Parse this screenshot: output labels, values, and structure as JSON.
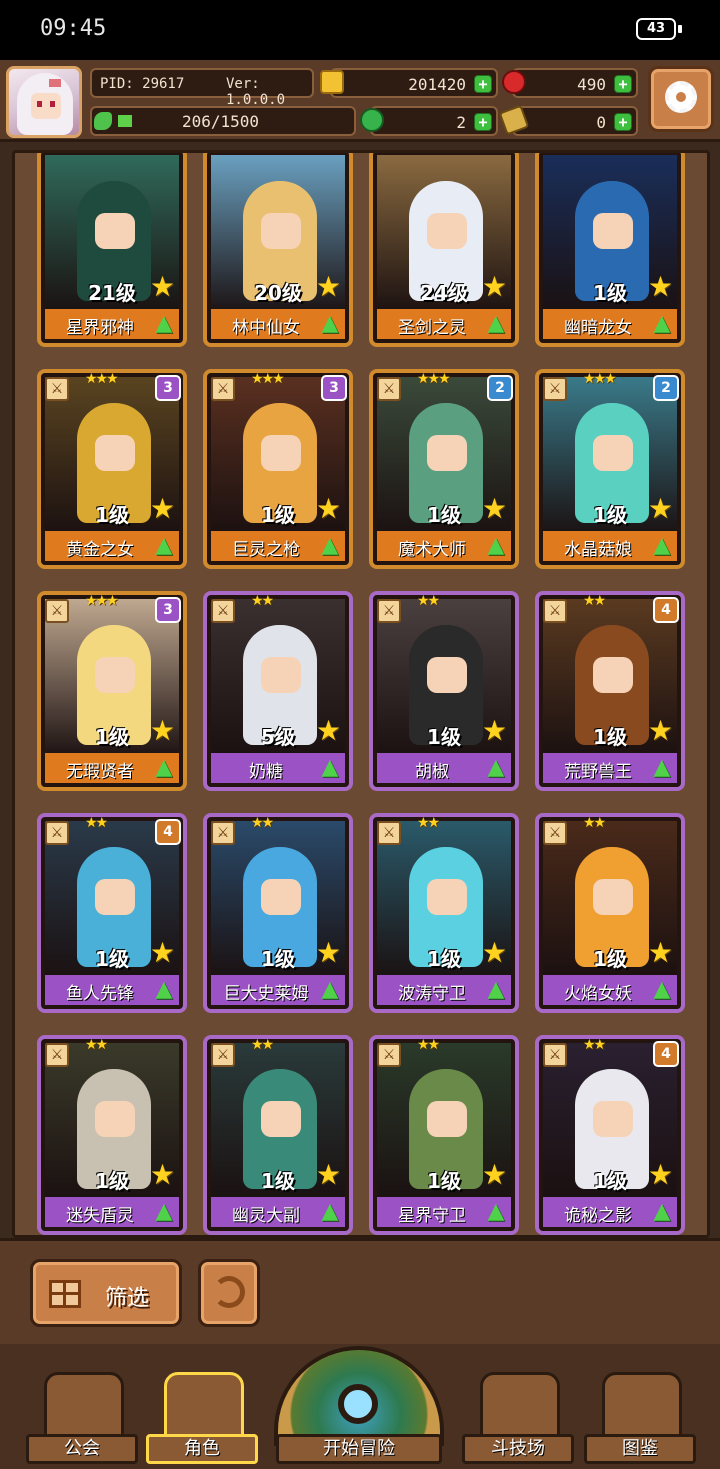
{
  "status": {
    "time": "09:45",
    "battery": "43"
  },
  "header": {
    "pid": "PID: 29617",
    "version": "Ver: 1.0.0.0",
    "exp_text": "206/1500",
    "exp_fraction": 0.137,
    "gold": "201420",
    "ruby": "490",
    "clover": "2",
    "scroll": "0"
  },
  "cards": [
    {
      "name": "星界邪神",
      "level": "21级",
      "frame": "orange",
      "color": "#2f6a5a",
      "hair": "#1f4a3e",
      "row": 0,
      "col": 0
    },
    {
      "name": "林中仙女",
      "level": "20级",
      "frame": "orange",
      "color": "#6aa0c0",
      "hair": "#e8c070",
      "row": 0,
      "col": 1
    },
    {
      "name": "圣剑之灵",
      "level": "24级",
      "frame": "orange",
      "color": "#8a6a40",
      "hair": "#e8ecf4",
      "row": 0,
      "col": 2
    },
    {
      "name": "幽暗龙女",
      "level": "1级",
      "frame": "orange",
      "color": "#1a2e5a",
      "hair": "#2a6ab0",
      "row": 0,
      "col": 3
    },
    {
      "name": "黄金之女",
      "level": "1级",
      "frame": "orange",
      "color": "#5a4420",
      "hair": "#d8a830",
      "row": 1,
      "col": 0,
      "stars": "★★★",
      "badge": "3",
      "badge_color": "#9a52c4"
    },
    {
      "name": "巨灵之枪",
      "level": "1级",
      "frame": "orange",
      "color": "#5a3020",
      "hair": "#e8a440",
      "row": 1,
      "col": 1,
      "stars": "★★★",
      "badge": "3",
      "badge_color": "#9a52c4"
    },
    {
      "name": "魔术大师",
      "level": "1级",
      "frame": "orange",
      "color": "#3a4a3a",
      "hair": "#5aa080",
      "row": 1,
      "col": 2,
      "stars": "★★★",
      "badge": "2",
      "badge_color": "#3a8ad0"
    },
    {
      "name": "水晶菇娘",
      "level": "1级",
      "frame": "orange",
      "color": "#3a7a8a",
      "hair": "#5ad0c0",
      "row": 1,
      "col": 3,
      "stars": "★★★",
      "badge": "2",
      "badge_color": "#3a8ad0"
    },
    {
      "name": "无瑕贤者",
      "level": "1级",
      "frame": "orange",
      "color": "#c0a890",
      "hair": "#f4d880",
      "row": 2,
      "col": 0,
      "stars": "★★★",
      "badge": "3",
      "badge_color": "#9a52c4"
    },
    {
      "name": "奶糖",
      "level": "5级",
      "frame": "purple",
      "color": "#3a3030",
      "hair": "#e0e4ea",
      "row": 2,
      "col": 1,
      "stars": "★★"
    },
    {
      "name": "胡椒",
      "level": "1级",
      "frame": "purple",
      "color": "#4a4040",
      "hair": "#2a2a2a",
      "row": 2,
      "col": 2,
      "stars": "★★"
    },
    {
      "name": "荒野兽王",
      "level": "1级",
      "frame": "purple",
      "color": "#5a3a20",
      "hair": "#8a4a20",
      "row": 2,
      "col": 3,
      "stars": "★★",
      "badge": "4",
      "badge_color": "#d07a2a"
    },
    {
      "name": "鱼人先锋",
      "level": "1级",
      "frame": "purple",
      "color": "#2a3a4a",
      "hair": "#4ab0d8",
      "row": 3,
      "col": 0,
      "stars": "★★",
      "badge": "4",
      "badge_color": "#d07a2a"
    },
    {
      "name": "巨大史莱姆",
      "level": "1级",
      "frame": "purple",
      "color": "#2a4a6a",
      "hair": "#4aa8e0",
      "row": 3,
      "col": 1,
      "stars": "★★"
    },
    {
      "name": "波涛守卫",
      "level": "1级",
      "frame": "purple",
      "color": "#2a5a6a",
      "hair": "#5ad0e0",
      "row": 3,
      "col": 2,
      "stars": "★★"
    },
    {
      "name": "火焰女妖",
      "level": "1级",
      "frame": "purple",
      "color": "#4a2a1a",
      "hair": "#f0a030",
      "row": 3,
      "col": 3,
      "stars": "★★"
    },
    {
      "name": "迷失盾灵",
      "level": "1级",
      "frame": "purple",
      "color": "#3a3a2a",
      "hair": "#c8c0b0",
      "row": 4,
      "col": 0,
      "stars": "★★"
    },
    {
      "name": "幽灵大副",
      "level": "1级",
      "frame": "purple",
      "color": "#2a3a3a",
      "hair": "#3a8a7a",
      "row": 4,
      "col": 1,
      "stars": "★★"
    },
    {
      "name": "星界守卫",
      "level": "1级",
      "frame": "purple",
      "color": "#2a3a2a",
      "hair": "#6a8a4a",
      "row": 4,
      "col": 2,
      "stars": "★★"
    },
    {
      "name": "诡秘之影",
      "level": "1级",
      "frame": "purple",
      "color": "#2a2030",
      "hair": "#e8e8ee",
      "row": 4,
      "col": 3,
      "stars": "★★",
      "badge": "4",
      "badge_color": "#d07a2a"
    }
  ],
  "controls": {
    "filter_label": "筛选"
  },
  "nav": {
    "guild": "公会",
    "character": "角色",
    "adventure": "开始冒险",
    "arena": "斗技场",
    "codex": "图鉴"
  }
}
